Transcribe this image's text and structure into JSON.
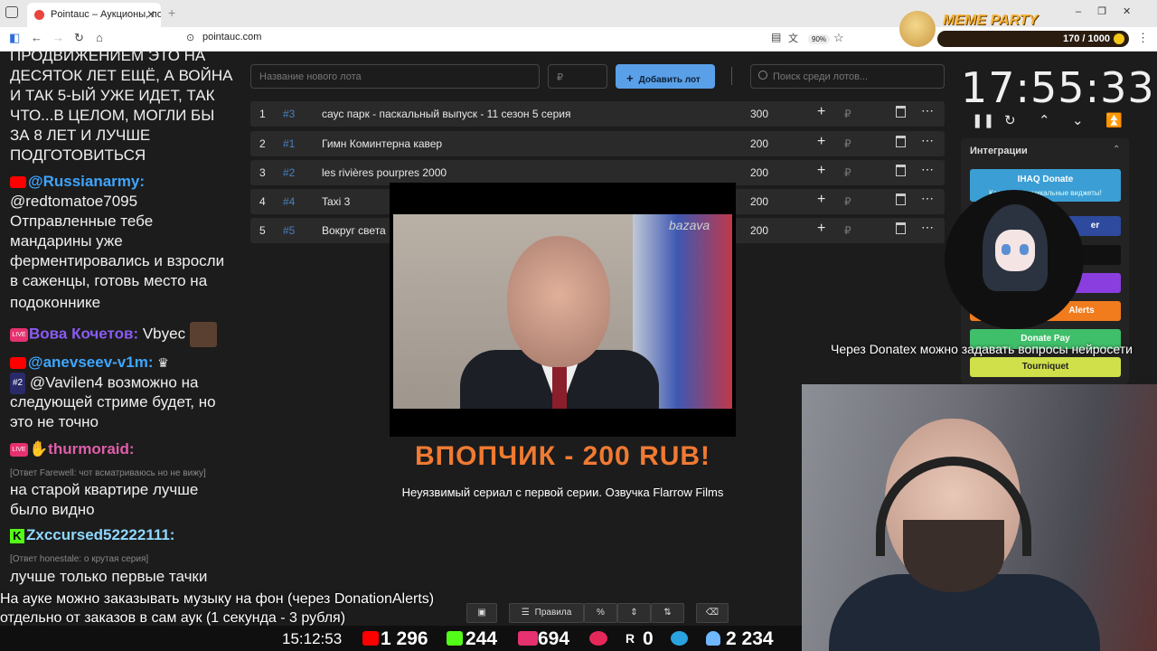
{
  "browser": {
    "tab_title": "Pointauc – Аукционы, лотереи",
    "url": "pointauc.com",
    "zoom": "90%"
  },
  "overlay": {
    "meme_party": "MEME PARTY",
    "points": "170 / 1000"
  },
  "chat": {
    "lines": [
      "ПРОДВИЖЕНИЕМ ЭТО НА",
      "ДЕСЯТОК ЛЕТ ЕЩЁ, А ВОЙНА",
      "И ТАК 5-ЫЙ УЖЕ ИДЕТ, ТАК",
      "ЧТО...В ЦЕЛОМ, МОГЛИ БЫ",
      "ЗА 8 ЛЕТ И ЛУЧШЕ",
      "ПОДГОТОВИТЬСЯ"
    ],
    "msg1_nick": "@Russianarmy:",
    "msg1_lines": [
      "@redtomatoe7095",
      "Отправленные тебе",
      "мандарины уже",
      "ферментировались и взросли",
      "в саженцы, готовь место на",
      "подоконнике"
    ],
    "msg2_nick": "Вова Кочетов:",
    "msg2_text": "Vbyec",
    "msg3_nick": "@anevseev-v1m:",
    "msg3_tag": "#2",
    "msg3_lines": [
      "@Vavilen4 возможно на",
      "следующей стриме будет, но",
      "это не точно"
    ],
    "msg4_nick": "thurmoraid:",
    "msg4_reply": "[Ответ Farewell: чот всматриваюсь но не вижу]",
    "msg4_lines": [
      "на старой квартире лучше",
      "было видно"
    ],
    "msg5_nick": "Zxccursed52222111:",
    "msg5_reply": "[Ответ honestale: о крутая серия]",
    "msg5_lines": [
      "лучше только первые тачки"
    ],
    "live_badge": "LIVE"
  },
  "auction": {
    "lot_name_placeholder": "Название нового лота",
    "price_placeholder": "₽",
    "add_button": "Добавить лот",
    "search_placeholder": "Поиск среди лотов...",
    "currency": "₽",
    "lots": [
      {
        "n": "1",
        "id": "#3",
        "name": "саус парк - паскальный выпуск - 11 сезон 5 серия",
        "amount": "300"
      },
      {
        "n": "2",
        "id": "#1",
        "name": "Гимн Коминтерна кавер",
        "amount": "200"
      },
      {
        "n": "3",
        "id": "#2",
        "name": "les rivières pourpres 2000",
        "amount": "200"
      },
      {
        "n": "4",
        "id": "#4",
        "name": "Taxi 3",
        "amount": "200"
      },
      {
        "n": "5",
        "id": "#5",
        "name": "Вокруг света",
        "amount": "200"
      }
    ]
  },
  "video": {
    "watermark": "bazava",
    "title": "ВПОПЧИК - 200 RUB!",
    "subtitle": "Неуязвимый сериал с первой серии. Озвучка Flarrow Films"
  },
  "timer": {
    "time": "17:55:33"
  },
  "integrations": {
    "title": "Интеграции",
    "ihaq": "IHAQ Donate",
    "ihaq_sub": "Кастомные уникальные виджеты!",
    "partial1": "er",
    "alerts": "Alerts",
    "donatepay": "Donate Pay",
    "tourniquet": "Tourniquet"
  },
  "donatex_notice": "Через Donatex можно задавать вопросы нейросети",
  "notice_lines": [
    "На ауке можно заказывать музыку на фон (через DonationAlerts)",
    "отдельно от заказов в сам аук (1 секунда - 3 рубля)"
  ],
  "toolbar": {
    "rules": "Правила",
    "percent": "%"
  },
  "stats": {
    "time": "15:12:53",
    "youtube": "1 296",
    "kick": "244",
    "vk": "694",
    "rutube": "0",
    "viewers": "2 234"
  },
  "colors": {
    "accent_blue": "#5aa0e8",
    "id_blue": "#4a7fc0",
    "video_title_orange": "#f07a32",
    "youtube_red": "#ff0000",
    "kick_green": "#53fc18",
    "vk_pink": "#e53170"
  }
}
